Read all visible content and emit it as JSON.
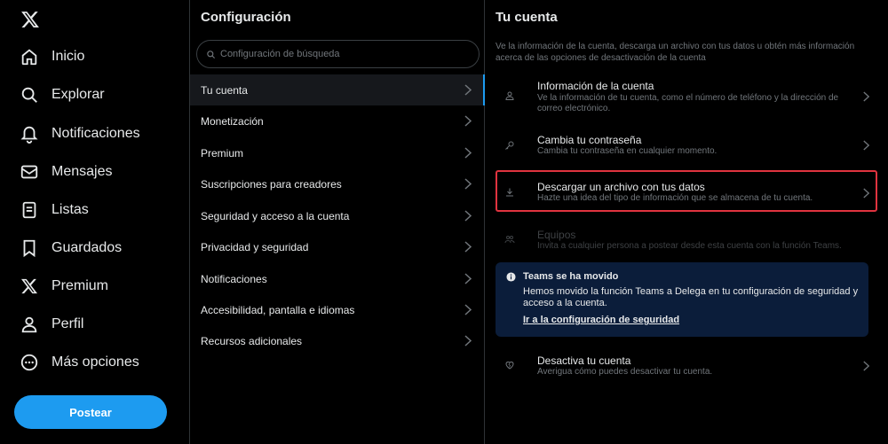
{
  "nav": {
    "items": [
      {
        "label": "Inicio",
        "icon": "home-icon"
      },
      {
        "label": "Explorar",
        "icon": "search-icon"
      },
      {
        "label": "Notificaciones",
        "icon": "bell-icon"
      },
      {
        "label": "Mensajes",
        "icon": "envelope-icon"
      },
      {
        "label": "Listas",
        "icon": "list-icon"
      },
      {
        "label": "Guardados",
        "icon": "bookmark-icon"
      },
      {
        "label": "Premium",
        "icon": "x-logo-icon"
      },
      {
        "label": "Perfil",
        "icon": "user-icon"
      },
      {
        "label": "Más opciones",
        "icon": "more-circle-icon"
      }
    ],
    "post_label": "Postear"
  },
  "settings": {
    "title": "Configuración",
    "search_placeholder": "Configuración de búsqueda",
    "items": [
      {
        "label": "Tu cuenta",
        "active": true
      },
      {
        "label": "Monetización"
      },
      {
        "label": "Premium"
      },
      {
        "label": "Suscripciones para creadores"
      },
      {
        "label": "Seguridad y acceso a la cuenta"
      },
      {
        "label": "Privacidad y seguridad"
      },
      {
        "label": "Notificaciones"
      },
      {
        "label": "Accesibilidad, pantalla e idiomas"
      },
      {
        "label": "Recursos adicionales"
      }
    ]
  },
  "account": {
    "title": "Tu cuenta",
    "intro": "Ve la información de la cuenta, descarga un archivo con tus datos u obtén más información acerca de las opciones de desactivación de la cuenta",
    "rows": [
      {
        "title": "Información de la cuenta",
        "desc": "Ve la información de tu cuenta, como el número de teléfono y la dirección de correo electrónico.",
        "icon": "user-icon"
      },
      {
        "title": "Cambia tu contraseña",
        "desc": "Cambia tu contraseña en cualquier momento.",
        "icon": "key-icon"
      },
      {
        "title": "Descargar un archivo con tus datos",
        "desc": "Hazte una idea del tipo de información que se almacena de tu cuenta.",
        "icon": "download-icon"
      },
      {
        "title": "Equipos",
        "desc": "Invita a cualquier persona a postear desde esta cuenta con la función Teams.",
        "icon": "team-icon"
      }
    ],
    "notice": {
      "title": "Teams se ha movido",
      "body": "Hemos movido la función Teams a Delega en tu configuración de seguridad y acceso a la cuenta.",
      "link": "Ir a la configuración de seguridad"
    },
    "deactivate": {
      "title": "Desactiva tu cuenta",
      "desc": "Averigua cómo puedes desactivar tu cuenta.",
      "icon": "broken-heart-icon"
    }
  },
  "colors": {
    "accent": "#1d9bf0",
    "highlight": "#e0333f",
    "notice_bg": "#0b1d3a"
  }
}
